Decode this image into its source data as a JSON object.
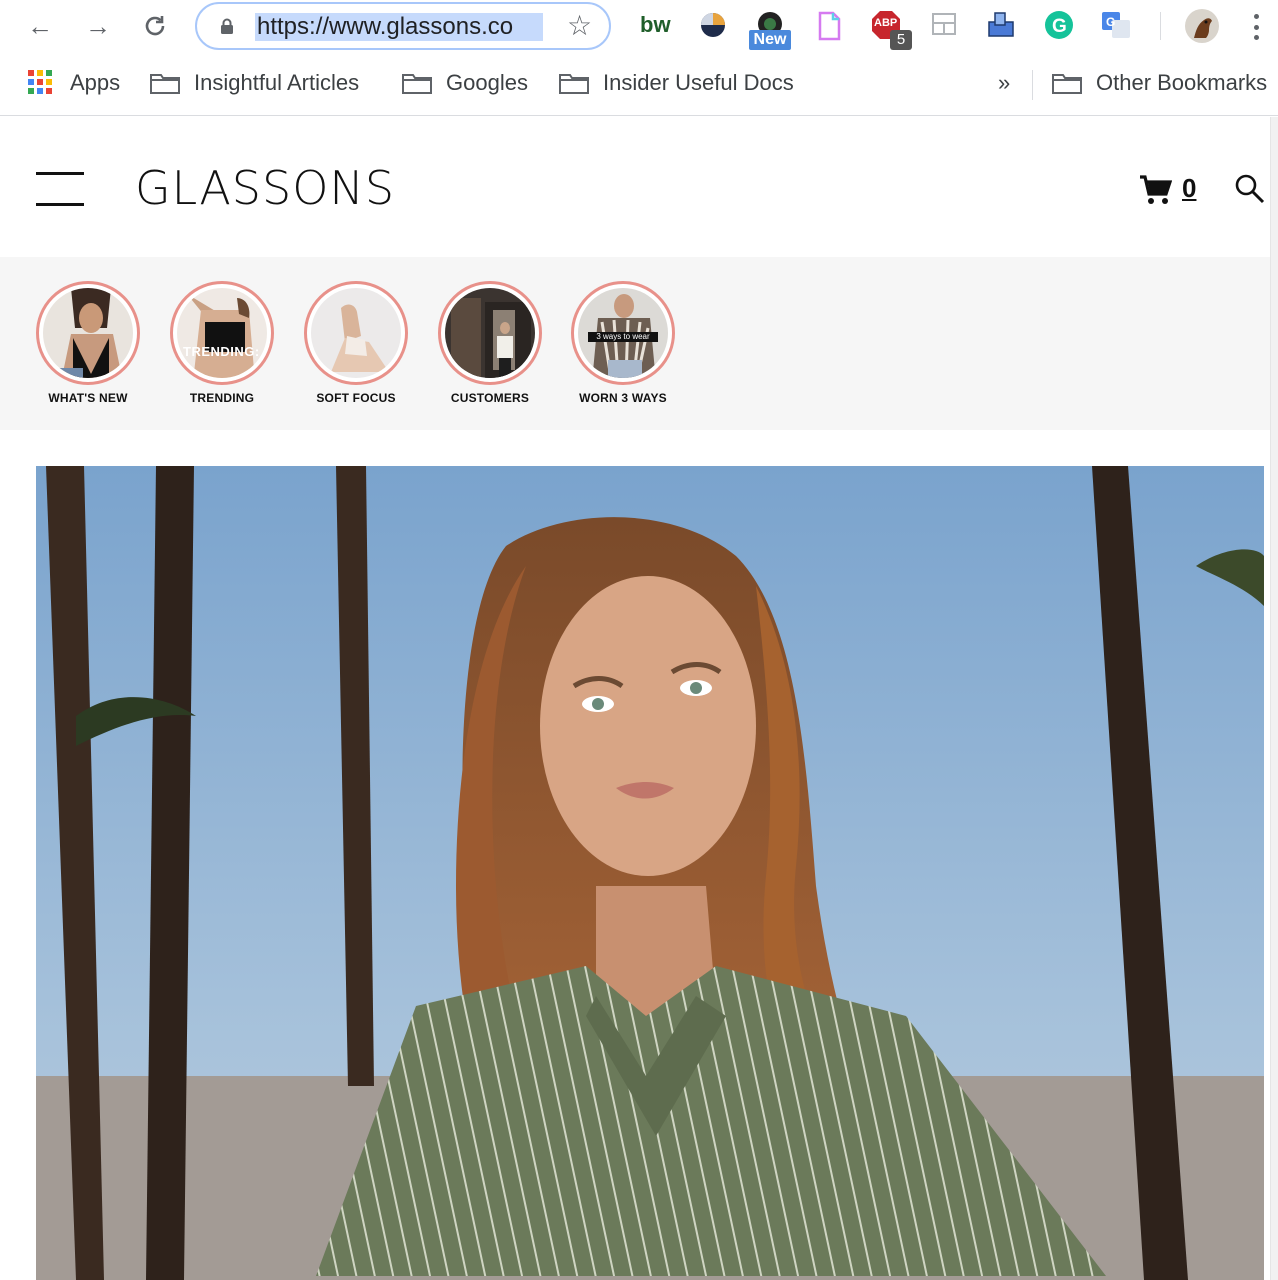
{
  "browser": {
    "url": "https://www.glassons.co",
    "extensions": {
      "new_badge": "New",
      "abp_label": "ABP",
      "abp_count": "5",
      "bw_label": "bw"
    }
  },
  "bookmarks": {
    "apps": "Apps",
    "items": [
      "Insightful Articles",
      "Googles",
      "Insider Useful Docs"
    ],
    "overflow": "»",
    "other": "Other Bookmarks"
  },
  "site": {
    "logo": "GLASSONS",
    "cart_count": "0"
  },
  "stories": [
    {
      "label": "WHAT'S NEW"
    },
    {
      "label": "TRENDING",
      "overlay": "TRENDING:"
    },
    {
      "label": "SOFT FOCUS"
    },
    {
      "label": "CUSTOMERS"
    },
    {
      "label": "WORN 3 WAYS",
      "overlay": "3 ways to wear"
    }
  ],
  "colors": {
    "story_ring": "#e8918a",
    "url_highlight": "#c6dafc",
    "sky": "#7ea8d2"
  }
}
